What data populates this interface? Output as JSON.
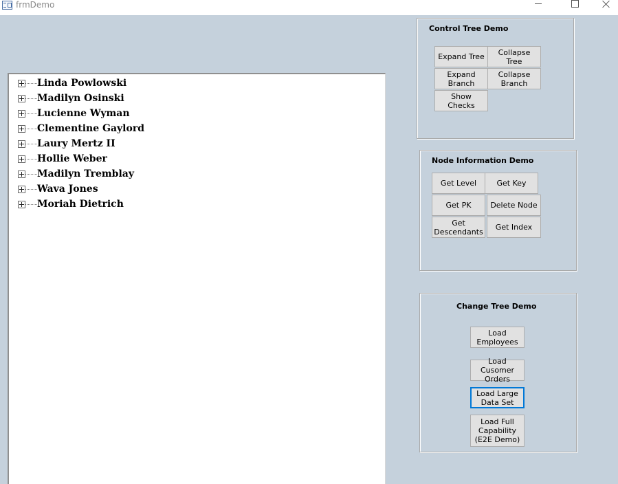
{
  "window": {
    "title": "frmDemo",
    "app_icon": "form-icon"
  },
  "tree": {
    "nodes": [
      {
        "label": "Linda Powlowski"
      },
      {
        "label": "Madilyn Osinski"
      },
      {
        "label": "Lucienne Wyman"
      },
      {
        "label": "Clementine Gaylord"
      },
      {
        "label": "Laury Mertz II"
      },
      {
        "label": "Hollie Weber"
      },
      {
        "label": "Madilyn Tremblay"
      },
      {
        "label": "Wava Jones"
      },
      {
        "label": "Moriah Dietrich"
      }
    ]
  },
  "control_tree": {
    "title": "Control Tree Demo",
    "expand_tree": "Expand Tree",
    "collapse_tree": "Collapse Tree",
    "expand_branch": "Expand Branch",
    "collapse_branch": "Collapse\nBranch",
    "show_checks": "Show Checks"
  },
  "node_info": {
    "title": "Node Information Demo",
    "get_level": "Get Level",
    "get_key": "Get Key",
    "get_pk": "Get PK",
    "delete_node": "Delete Node",
    "get_descendants": "Get\nDescendants",
    "get_index": "Get Index"
  },
  "change_tree": {
    "title": "Change Tree Demo",
    "load_employees": "Load\nEmployees",
    "load_customer_orders": "Load Cusomer\nOrders",
    "load_large_data": "Load Large\nData Set",
    "load_full_capability": "Load Full\nCapability\n(E2E Demo)"
  },
  "colors": {
    "form_background": "#c5d1dc",
    "button_face": "#e1e1e1",
    "focus_border": "#0078d7"
  }
}
